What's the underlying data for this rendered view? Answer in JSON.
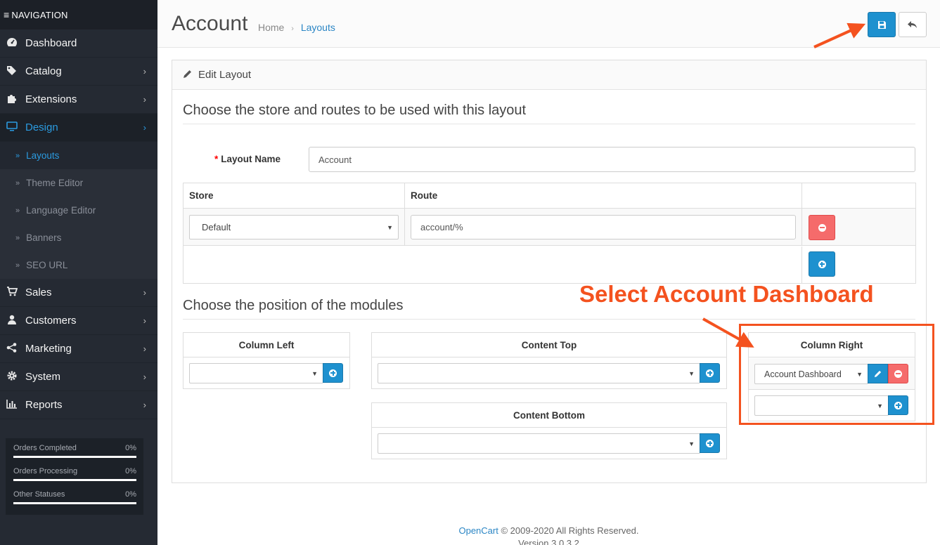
{
  "sidebar": {
    "header": "NAVIGATION",
    "items": [
      {
        "label": "Dashboard",
        "icon": "dashboard-icon"
      },
      {
        "label": "Catalog",
        "icon": "tags-icon"
      },
      {
        "label": "Extensions",
        "icon": "puzzle-icon"
      },
      {
        "label": "Design",
        "icon": "monitor-icon"
      },
      {
        "label": "Sales",
        "icon": "cart-icon"
      },
      {
        "label": "Customers",
        "icon": "user-icon"
      },
      {
        "label": "Marketing",
        "icon": "share-icon"
      },
      {
        "label": "System",
        "icon": "gear-icon"
      },
      {
        "label": "Reports",
        "icon": "bar-chart-icon"
      }
    ],
    "design_subitems": [
      "Layouts",
      "Theme Editor",
      "Language Editor",
      "Banners",
      "SEO URL"
    ],
    "stats": [
      {
        "label": "Orders Completed",
        "value": "0%"
      },
      {
        "label": "Orders Processing",
        "value": "0%"
      },
      {
        "label": "Other Statuses",
        "value": "0%"
      }
    ]
  },
  "header": {
    "title": "Account",
    "breadcrumb": [
      "Home",
      "Layouts"
    ]
  },
  "panel": {
    "title": "Edit Layout",
    "legend_routes": "Choose the store and routes to be used with this layout",
    "layout_name_label": "Layout Name",
    "layout_name_value": "Account",
    "route_table": {
      "headers": [
        "Store",
        "Route"
      ],
      "rows": [
        {
          "store": "Default",
          "route": "account/%"
        }
      ]
    },
    "legend_modules": "Choose the position of the modules",
    "positions": {
      "column_left": "Column Left",
      "content_top": "Content Top",
      "content_bottom": "Content Bottom",
      "column_right": "Column Right"
    },
    "column_right_module": "Account Dashboard"
  },
  "annotation": "Select Account Dashboard",
  "footer": {
    "brand": "OpenCart",
    "copyright": " © 2009-2020 All Rights Reserved.",
    "version": "Version 3.0.3.2"
  },
  "colors": {
    "sidebar_bg": "#252a33",
    "accent": "#1e91cf",
    "danger": "#f56b6b",
    "annotation": "#f4521f"
  }
}
